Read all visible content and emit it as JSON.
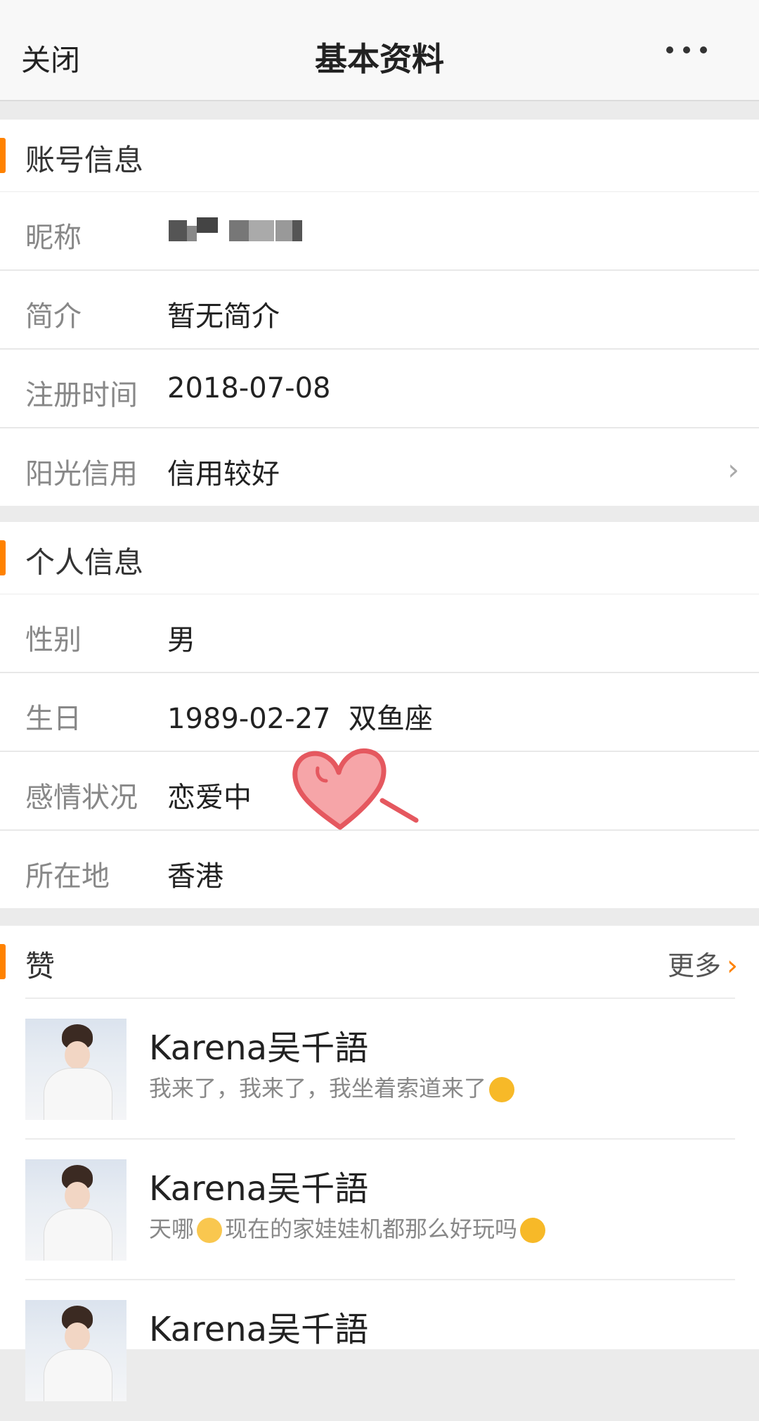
{
  "header": {
    "close_label": "关闭",
    "title": "基本资料",
    "more_icon": "more-dots-icon"
  },
  "account": {
    "title": "账号信息",
    "rows": [
      {
        "key": "昵称",
        "value": ""
      },
      {
        "key": "简介",
        "value": "暂无简介"
      },
      {
        "key": "注册时间",
        "value": "2018-07-08"
      },
      {
        "key": "阳光信用",
        "value": "信用较好"
      }
    ]
  },
  "personal": {
    "title": "个人信息",
    "rows": [
      {
        "key": "性别",
        "value": "男"
      },
      {
        "key": "生日",
        "value": "1989-02-27  双鱼座"
      },
      {
        "key": "感情状况",
        "value": "恋爱中"
      },
      {
        "key": "所在地",
        "value": "香港"
      }
    ]
  },
  "likes": {
    "title": "赞",
    "more_label": "更多",
    "items": [
      {
        "name": "Karena吴千語",
        "msg_a": "我来了，我来了，我坐着索道来了",
        "msg_b": ""
      },
      {
        "name": "Karena吴千語",
        "msg_a": "天哪",
        "msg_b": "现在的家娃娃机都那么好玩吗"
      },
      {
        "name": "Karena吴千語",
        "msg_a": "",
        "msg_b": ""
      }
    ]
  },
  "colors": {
    "accent": "#ff8200",
    "heart": "#f08a8f"
  }
}
